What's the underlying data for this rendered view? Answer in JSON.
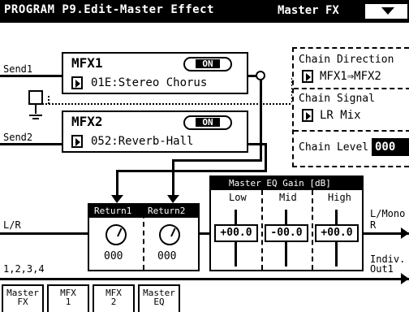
{
  "header": {
    "title": "PROGRAM P9.Edit-Master Effect",
    "page_tab": "Master FX"
  },
  "routing": {
    "send1": "Send1",
    "send2": "Send2",
    "lr": "L/R",
    "outs": "1,2,3,4",
    "l_mono": "L/Mono",
    "r": "R",
    "indiv": "Indiv.",
    "out1": "Out1"
  },
  "mfx1": {
    "name": "MFX1",
    "on_label": "ON",
    "effect": "01E:Stereo Chorus"
  },
  "mfx2": {
    "name": "MFX2",
    "on_label": "ON",
    "effect": "052:Reverb-Hall"
  },
  "chain": {
    "direction_label": "Chain Direction",
    "direction_value": "MFX1⇒MFX2",
    "signal_label": "Chain Signal",
    "signal_value": "LR Mix",
    "level_label": "Chain Level",
    "level_value": "000"
  },
  "returns": {
    "return1_label": "Return1",
    "return2_label": "Return2",
    "return1_value": "000",
    "return2_value": "000"
  },
  "master_eq": {
    "title": "Master EQ Gain [dB]",
    "low_label": "Low",
    "mid_label": "Mid",
    "high_label": "High",
    "low_value": "+00.0",
    "mid_value": "-00.0",
    "high_value": "+00.0"
  },
  "tabs": [
    {
      "line1": "Master",
      "line2": "FX"
    },
    {
      "line1": "MFX",
      "line2": "1"
    },
    {
      "line1": "MFX",
      "line2": "2"
    },
    {
      "line1": "Master",
      "line2": "EQ"
    }
  ]
}
